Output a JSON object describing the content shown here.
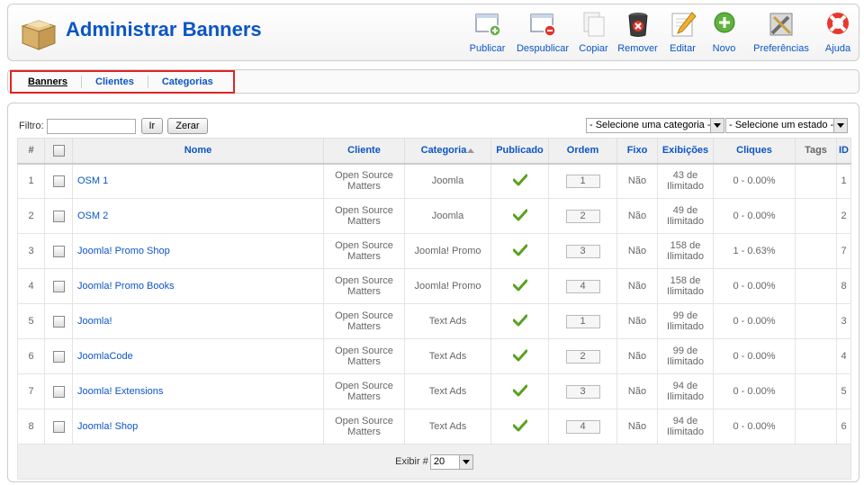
{
  "header": {
    "title": "Administrar Banners",
    "toolbar": [
      {
        "label": "Publicar",
        "icon": "publish-icon"
      },
      {
        "label": "Despublicar",
        "icon": "unpublish-icon"
      },
      {
        "label": "Copiar",
        "icon": "copy-icon"
      },
      {
        "label": "Remover",
        "icon": "trash-icon"
      },
      {
        "label": "Editar",
        "icon": "edit-icon"
      },
      {
        "label": "Novo",
        "icon": "new-icon"
      },
      {
        "label": "Preferências",
        "icon": "preferences-icon"
      },
      {
        "label": "Ajuda",
        "icon": "help-icon"
      }
    ]
  },
  "submenu": {
    "items": [
      "Banners",
      "Clientes",
      "Categorias"
    ],
    "active": "Banners"
  },
  "filter": {
    "label": "Filtro:",
    "value": "",
    "go_label": "Ir",
    "reset_label": "Zerar",
    "category_select": "- Selecione uma categoria -",
    "state_select": "- Selecione um estado -"
  },
  "table": {
    "headers": [
      "#",
      "",
      "Nome",
      "Cliente",
      "Categoria",
      "Publicado",
      "Ordem",
      "Fixo",
      "Exibições",
      "Cliques",
      "Tags",
      "ID"
    ],
    "rows": [
      {
        "num": "1",
        "name": "OSM 1",
        "client_l1": "Open Source",
        "client_l2": "Matters",
        "category": "Joomla",
        "order": "1",
        "sticky": "Não",
        "imp_l1": "43 de",
        "imp_l2": "Ilimitado",
        "clicks": "0 - 0.00%",
        "tags": "",
        "id": "1"
      },
      {
        "num": "2",
        "name": "OSM 2",
        "client_l1": "Open Source",
        "client_l2": "Matters",
        "category": "Joomla",
        "order": "2",
        "sticky": "Não",
        "imp_l1": "49 de",
        "imp_l2": "Ilimitado",
        "clicks": "0 - 0.00%",
        "tags": "",
        "id": "2"
      },
      {
        "num": "3",
        "name": "Joomla! Promo Shop",
        "client_l1": "Open Source",
        "client_l2": "Matters",
        "category": "Joomla! Promo",
        "order": "3",
        "sticky": "Não",
        "imp_l1": "158 de",
        "imp_l2": "Ilimitado",
        "clicks": "1 - 0.63%",
        "tags": "",
        "id": "7"
      },
      {
        "num": "4",
        "name": "Joomla! Promo Books",
        "client_l1": "Open Source",
        "client_l2": "Matters",
        "category": "Joomla! Promo",
        "order": "4",
        "sticky": "Não",
        "imp_l1": "158 de",
        "imp_l2": "Ilimitado",
        "clicks": "0 - 0.00%",
        "tags": "",
        "id": "8"
      },
      {
        "num": "5",
        "name": "Joomla!",
        "client_l1": "Open Source",
        "client_l2": "Matters",
        "category": "Text Ads",
        "order": "1",
        "sticky": "Não",
        "imp_l1": "99 de",
        "imp_l2": "Ilimitado",
        "clicks": "0 - 0.00%",
        "tags": "",
        "id": "3"
      },
      {
        "num": "6",
        "name": "JoomlaCode",
        "client_l1": "Open Source",
        "client_l2": "Matters",
        "category": "Text Ads",
        "order": "2",
        "sticky": "Não",
        "imp_l1": "99 de",
        "imp_l2": "Ilimitado",
        "clicks": "0 - 0.00%",
        "tags": "",
        "id": "4"
      },
      {
        "num": "7",
        "name": "Joomla! Extensions",
        "client_l1": "Open Source",
        "client_l2": "Matters",
        "category": "Text Ads",
        "order": "3",
        "sticky": "Não",
        "imp_l1": "94 de",
        "imp_l2": "Ilimitado",
        "clicks": "0 - 0.00%",
        "tags": "",
        "id": "5"
      },
      {
        "num": "8",
        "name": "Joomla! Shop",
        "client_l1": "Open Source",
        "client_l2": "Matters",
        "category": "Text Ads",
        "order": "4",
        "sticky": "Não",
        "imp_l1": "94 de",
        "imp_l2": "Ilimitado",
        "clicks": "0 - 0.00%",
        "tags": "",
        "id": "6"
      }
    ],
    "footer": {
      "display_label": "Exibir #",
      "display_value": "20"
    }
  },
  "colors": {
    "link": "#0b55c4",
    "highlight_border": "#e02424",
    "published_check": "#5aa021"
  }
}
